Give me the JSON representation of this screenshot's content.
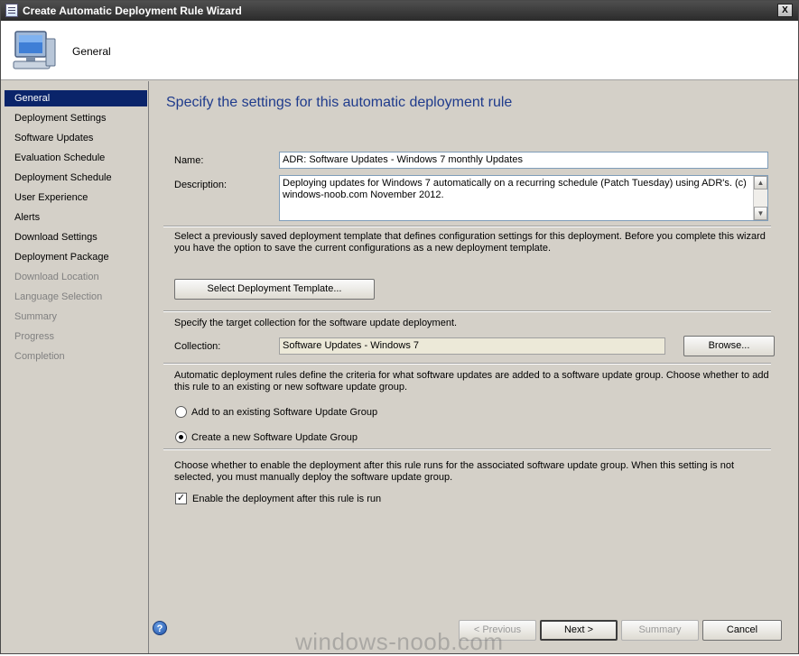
{
  "window": {
    "title": "Create Automatic Deployment Rule Wizard",
    "close_glyph": "X"
  },
  "header": {
    "title": "General",
    "icon": "computer-icon"
  },
  "sidebar": {
    "items": [
      {
        "label": "General",
        "state": "active"
      },
      {
        "label": "Deployment Settings",
        "state": "enabled"
      },
      {
        "label": "Software Updates",
        "state": "enabled"
      },
      {
        "label": "Evaluation Schedule",
        "state": "enabled"
      },
      {
        "label": "Deployment Schedule",
        "state": "enabled"
      },
      {
        "label": "User Experience",
        "state": "enabled"
      },
      {
        "label": "Alerts",
        "state": "enabled"
      },
      {
        "label": "Download Settings",
        "state": "enabled"
      },
      {
        "label": "Deployment Package",
        "state": "enabled"
      },
      {
        "label": "Download Location",
        "state": "disabled"
      },
      {
        "label": "Language Selection",
        "state": "disabled"
      },
      {
        "label": "Summary",
        "state": "disabled"
      },
      {
        "label": "Progress",
        "state": "disabled"
      },
      {
        "label": "Completion",
        "state": "disabled"
      }
    ]
  },
  "main": {
    "page_title": "Specify the settings for this automatic deployment rule",
    "name_label": "Name:",
    "name_value": "ADR: Software Updates - Windows 7 monthly Updates",
    "description_label": "Description:",
    "description_value": "Deploying updates for Windows 7 automatically on a recurring schedule (Patch Tuesday) using ADR's. (c) windows-noob.com November 2012.",
    "template_text": "Select a previously saved deployment template that defines configuration settings for this deployment. Before you complete this wizard you have the option to save the current configurations as a new deployment template.",
    "select_template_button": "Select Deployment Template...",
    "collection_text": "Specify the target collection for the software update deployment.",
    "collection_label": "Collection:",
    "collection_value": "Software Updates - Windows 7",
    "browse_button": "Browse...",
    "group_text": "Automatic deployment rules define the criteria for what software updates are added to a software update group. Choose whether to add this rule to an existing or new software update group.",
    "radio_existing_label": "Add to an existing Software Update Group",
    "radio_new_label": "Create a new Software Update Group",
    "selected_group_option": "new",
    "enable_text": "Choose whether to enable the deployment after this rule runs for the associated software update group. When this setting is not selected, you must manually deploy the software update group.",
    "enable_checkbox_label": "Enable the deployment after this rule is run",
    "enable_checked": true,
    "check_glyph": "✓"
  },
  "footer": {
    "help_glyph": "?",
    "previous_button": "< Previous",
    "next_button": "Next >",
    "summary_button": "Summary",
    "cancel_button": "Cancel"
  },
  "watermark": "windows-noob.com"
}
